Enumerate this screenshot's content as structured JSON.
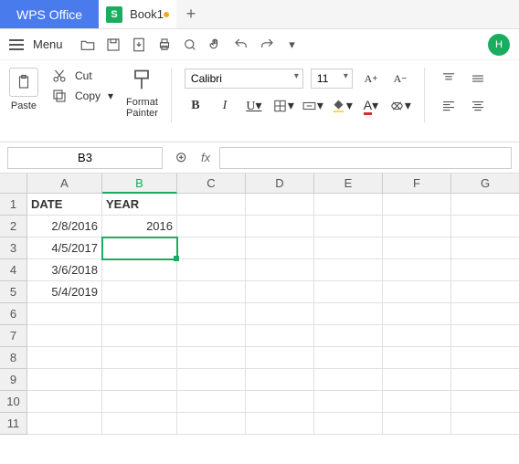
{
  "titlebar": {
    "app": "WPS Office",
    "doc": "Book1",
    "doc_icon": "S",
    "profile": "H"
  },
  "menu": {
    "label": "Menu"
  },
  "ribbon": {
    "paste": "Paste",
    "cut": "Cut",
    "copy": "Copy",
    "format_painter": "Format\nPainter",
    "font_name": "Calibri",
    "font_size": "11"
  },
  "namebox": {
    "cell_ref": "B3",
    "fx": "fx"
  },
  "grid": {
    "cols": [
      "A",
      "B",
      "C",
      "D",
      "E",
      "F",
      "G"
    ],
    "rows": [
      "1",
      "2",
      "3",
      "4",
      "5",
      "6",
      "7",
      "8",
      "9",
      "10",
      "11"
    ],
    "active_col": "B",
    "active_row": "3",
    "cells": {
      "A1": "DATE",
      "B1": "YEAR",
      "A2": "2/8/2016",
      "B2": "2016",
      "A3": "4/5/2017",
      "A4": "3/6/2018",
      "A5": "5/4/2019"
    }
  }
}
